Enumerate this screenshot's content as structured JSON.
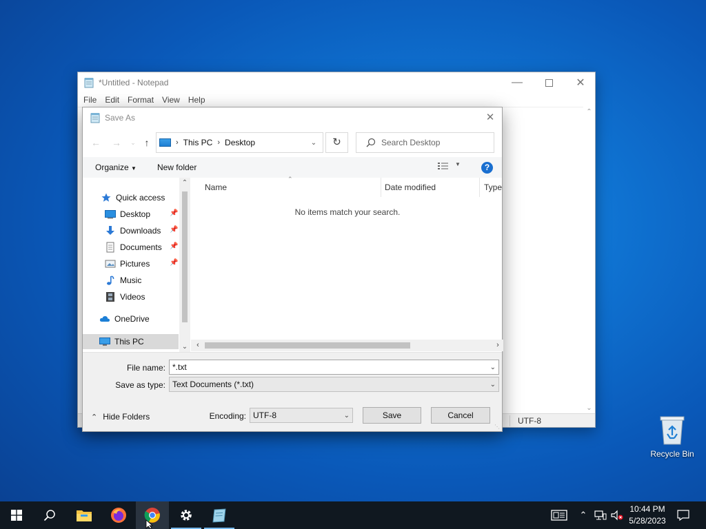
{
  "notepad": {
    "title": "*Untitled - Notepad",
    "menu": [
      "File",
      "Edit",
      "Format",
      "View",
      "Help"
    ],
    "status_encoding": "UTF-8"
  },
  "dialog": {
    "title": "Save As",
    "breadcrumb": [
      "This PC",
      "Desktop"
    ],
    "search_placeholder": "Search Desktop",
    "toolbar": {
      "organize": "Organize",
      "new_folder": "New folder",
      "help": "?"
    },
    "nav_items": [
      {
        "label": "Quick access",
        "icon": "star-icon"
      },
      {
        "label": "Desktop",
        "icon": "desktop-folder-icon",
        "pinned": true
      },
      {
        "label": "Downloads",
        "icon": "download-arrow-icon",
        "pinned": true
      },
      {
        "label": "Documents",
        "icon": "document-icon",
        "pinned": true
      },
      {
        "label": "Pictures",
        "icon": "picture-icon",
        "pinned": true
      },
      {
        "label": "Music",
        "icon": "music-note-icon"
      },
      {
        "label": "Videos",
        "icon": "film-icon"
      },
      {
        "label": "OneDrive",
        "icon": "cloud-icon"
      },
      {
        "label": "This PC",
        "icon": "computer-icon",
        "selected": true
      }
    ],
    "columns": [
      "Name",
      "Date modified",
      "Type"
    ],
    "empty_message": "No items match your search.",
    "file_name_label": "File name:",
    "file_name_value": "*.txt",
    "save_type_label": "Save as type:",
    "save_type_value": "Text Documents (*.txt)",
    "hide_folders": "Hide Folders",
    "encoding_label": "Encoding:",
    "encoding_value": "UTF-8",
    "save_button": "Save",
    "cancel_button": "Cancel"
  },
  "desktop": {
    "recycle_bin": "Recycle Bin"
  },
  "taskbar": {
    "time": "10:44 PM",
    "date": "5/28/2023",
    "accent": "#76b9ed"
  }
}
